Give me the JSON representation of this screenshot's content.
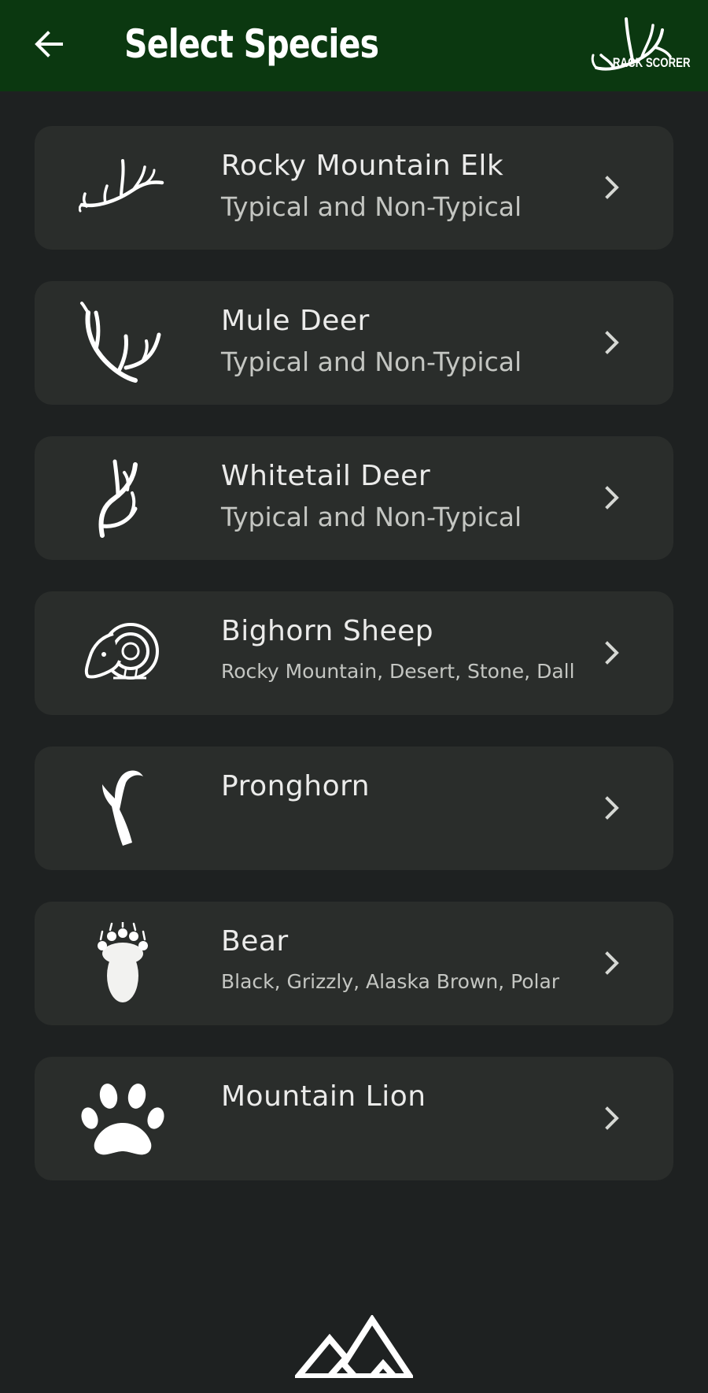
{
  "header": {
    "title": "Select Species",
    "back_icon": "arrow-left-icon",
    "brand_text": "RACK SCORER",
    "background_color": "#0b3810"
  },
  "species": [
    {
      "name": "Rocky Mountain Elk",
      "subtitle": "Typical and Non-Typical",
      "icon": "elk-antler-icon"
    },
    {
      "name": "Mule Deer",
      "subtitle": "Typical and Non-Typical",
      "icon": "mule-deer-antler-icon"
    },
    {
      "name": "Whitetail Deer",
      "subtitle": "Typical and Non-Typical",
      "icon": "whitetail-antler-icon"
    },
    {
      "name": "Bighorn Sheep",
      "subtitle": "Rocky Mountain, Desert, Stone, Dall",
      "icon": "ram-icon"
    },
    {
      "name": "Pronghorn",
      "subtitle": "",
      "icon": "pronghorn-horn-icon"
    },
    {
      "name": "Bear",
      "subtitle": "Black, Grizzly, Alaska Brown, Polar",
      "icon": "bear-paw-icon"
    },
    {
      "name": "Mountain Lion",
      "subtitle": "",
      "icon": "cat-paw-icon"
    }
  ],
  "colors": {
    "background": "#1e2121",
    "card": "#2a2d2b",
    "text": "#ebebea",
    "subtext": "#c4c6c2"
  }
}
